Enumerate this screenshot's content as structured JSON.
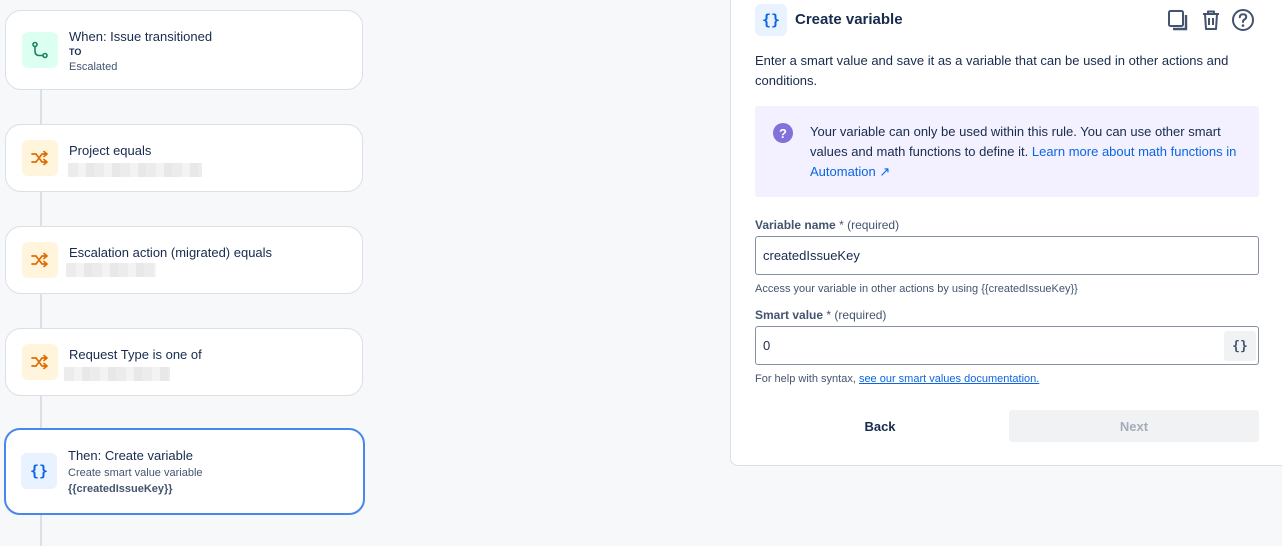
{
  "flow": {
    "trigger": {
      "title": "When: Issue transitioned",
      "to_label": "TO",
      "to_value": "Escalated"
    },
    "conditions": [
      {
        "title": "Project equals"
      },
      {
        "title": "Escalation action (migrated) equals"
      },
      {
        "title": "Request Type is one of"
      }
    ],
    "action": {
      "title": "Then: Create variable",
      "subtitle": "Create smart value variable",
      "value": "{{createdIssueKey}}"
    }
  },
  "panel": {
    "icon_glyph": "{}",
    "title": "Create variable",
    "description": "Enter a smart value and save it as a variable that can be used in other actions and conditions.",
    "info": {
      "text": "Your variable can only be used within this rule. You can use other smart values and math functions to define it. ",
      "link": "Learn more about math functions in Automation ↗"
    },
    "variable_name": {
      "label": "Variable name",
      "star": "*",
      "required": "(required)",
      "value": "createdIssueKey",
      "helper": "Access your variable in other actions by using {{createdIssueKey}}"
    },
    "smart_value": {
      "label": "Smart value",
      "star": "*",
      "required": "(required)",
      "value": "0",
      "button": "{}",
      "helper_prefix": "For help with syntax, ",
      "helper_link": "see our smart values documentation."
    },
    "back_label": "Back",
    "next_label": "Next"
  },
  "colors": {
    "accent": "#0c66e4",
    "selected_border": "#4688ec",
    "info_bg": "#f3f0ff"
  }
}
